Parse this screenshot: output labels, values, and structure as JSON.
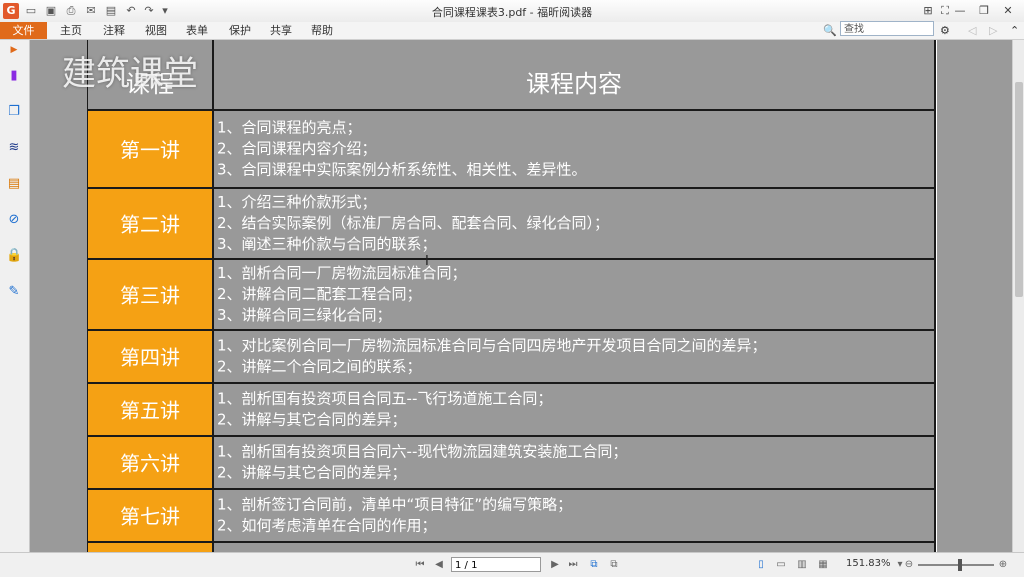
{
  "window": {
    "title": "合同课程课表3.pdf - 福昕阅读器"
  },
  "menu": {
    "file": "文件",
    "items": [
      "主页",
      "注释",
      "视图",
      "表单",
      "保护",
      "共享",
      "帮助"
    ]
  },
  "search": {
    "placeholder": "查找"
  },
  "watermark": "建筑课堂",
  "table": {
    "header_left": "课程",
    "header_right": "课程内容",
    "rows": [
      {
        "label": "第一讲",
        "lines": [
          "1、合同课程的亮点；",
          "2、合同课程内容介绍；",
          "3、合同课程中实际案例分析系统性、相关性、差异性。"
        ]
      },
      {
        "label": "第二讲",
        "lines": [
          "1、介绍三种价款形式；",
          "2、结合实际案例（标准厂房合同、配套合同、绿化合同）；",
          "3、阐述三种价款与合同的联系；"
        ]
      },
      {
        "label": "第三讲",
        "lines": [
          "1、剖析合同一厂房物流园标准合同；",
          "2、讲解合同二配套工程合同；",
          "3、讲解合同三绿化合同；"
        ]
      },
      {
        "label": "第四讲",
        "lines": [
          "1、对比案例合同一厂房物流园标准合同与合同四房地产开发项目合同之间的差异；",
          "2、讲解二个合同之间的联系；"
        ]
      },
      {
        "label": "第五讲",
        "lines": [
          "1、剖析国有投资项目合同五--飞行场道施工合同；",
          "2、讲解与其它合同的差异；"
        ]
      },
      {
        "label": "第六讲",
        "lines": [
          "1、剖析国有投资项目合同六--现代物流园建筑安装施工合同；",
          "2、讲解与其它合同的差异；"
        ]
      },
      {
        "label": "第七讲",
        "lines": [
          "1、剖析签订合同前，清单中“项目特征”的编写策略；",
          "2、如何考虑清单在合同的作用；"
        ]
      }
    ]
  },
  "status": {
    "page": "1 / 1",
    "zoom": "151.83%"
  },
  "colors": {
    "orange": "#f5a114",
    "gray_cell": "#999999",
    "file_menu": "#e06a1a"
  }
}
